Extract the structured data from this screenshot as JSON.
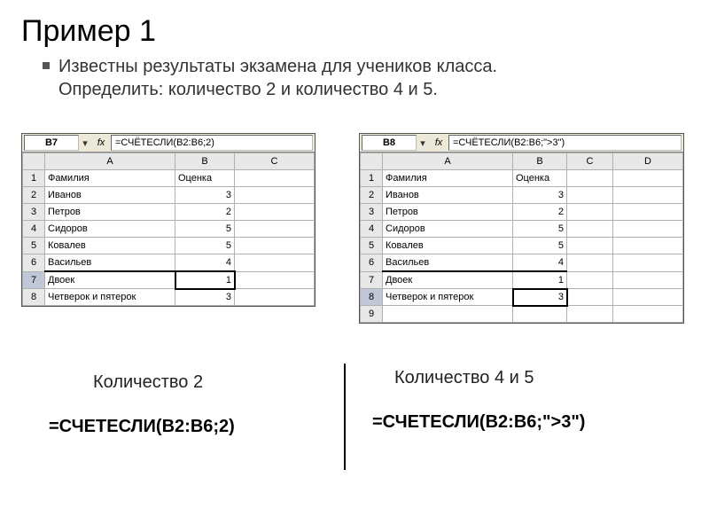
{
  "title": "Пример 1",
  "bullet_line1": "Известны результаты экзамена для учеников класса.",
  "bullet_line2": "Определить: количество 2 и количество 4 и 5.",
  "left_sheet": {
    "cellref": "B7",
    "fx_label": "fx",
    "formula": "=СЧЁТЕСЛИ(B2:B6;2)",
    "col_headers": [
      "",
      "A",
      "B",
      "C"
    ],
    "rows": [
      {
        "n": "1",
        "a": "Фамилия",
        "b": "Оценка",
        "c": ""
      },
      {
        "n": "2",
        "a": "Иванов",
        "b": "3",
        "c": ""
      },
      {
        "n": "3",
        "a": "Петров",
        "b": "2",
        "c": ""
      },
      {
        "n": "4",
        "a": "Сидоров",
        "b": "5",
        "c": ""
      },
      {
        "n": "5",
        "a": "Ковалев",
        "b": "5",
        "c": ""
      },
      {
        "n": "6",
        "a": "Васильев",
        "b": "4",
        "c": ""
      },
      {
        "n": "7",
        "a": "Двоек",
        "b": "1",
        "c": ""
      },
      {
        "n": "8",
        "a": "Четверок и пятерок",
        "b": "3",
        "c": ""
      }
    ],
    "selected_row": "7",
    "thick_after_row": "6"
  },
  "right_sheet": {
    "cellref": "B8",
    "fx_label": "fx",
    "formula": "=СЧЁТЕСЛИ(B2:B6;\">3\")",
    "col_headers": [
      "",
      "A",
      "B",
      "C",
      "D"
    ],
    "rows": [
      {
        "n": "1",
        "a": "Фамилия",
        "b": "Оценка",
        "c": "",
        "d": ""
      },
      {
        "n": "2",
        "a": "Иванов",
        "b": "3",
        "c": "",
        "d": ""
      },
      {
        "n": "3",
        "a": "Петров",
        "b": "2",
        "c": "",
        "d": ""
      },
      {
        "n": "4",
        "a": "Сидоров",
        "b": "5",
        "c": "",
        "d": ""
      },
      {
        "n": "5",
        "a": "Ковалев",
        "b": "5",
        "c": "",
        "d": ""
      },
      {
        "n": "6",
        "a": "Васильев",
        "b": "4",
        "c": "",
        "d": ""
      },
      {
        "n": "7",
        "a": "Двоек",
        "b": "1",
        "c": "",
        "d": ""
      },
      {
        "n": "8",
        "a": "Четверок и пятерок",
        "b": "3",
        "c": "",
        "d": ""
      },
      {
        "n": "9",
        "a": "",
        "b": "",
        "c": "",
        "d": ""
      }
    ],
    "selected_row": "8",
    "thick_after_row": "6"
  },
  "caption_left": "Количество 2",
  "caption_right": "Количество 4 и 5",
  "formula_left": "=СЧЕТЕСЛИ(B2:B6;2)",
  "formula_right": "=СЧЕТЕСЛИ(B2:B6;\">3\")",
  "chart_data": {
    "type": "table",
    "title": "Оценки учеников",
    "columns": [
      "Фамилия",
      "Оценка"
    ],
    "data": [
      [
        "Иванов",
        3
      ],
      [
        "Петров",
        2
      ],
      [
        "Сидоров",
        5
      ],
      [
        "Ковалев",
        5
      ],
      [
        "Васильев",
        4
      ]
    ],
    "derived": {
      "Двоек": 1,
      "Четверок и пятерок": 3
    }
  }
}
